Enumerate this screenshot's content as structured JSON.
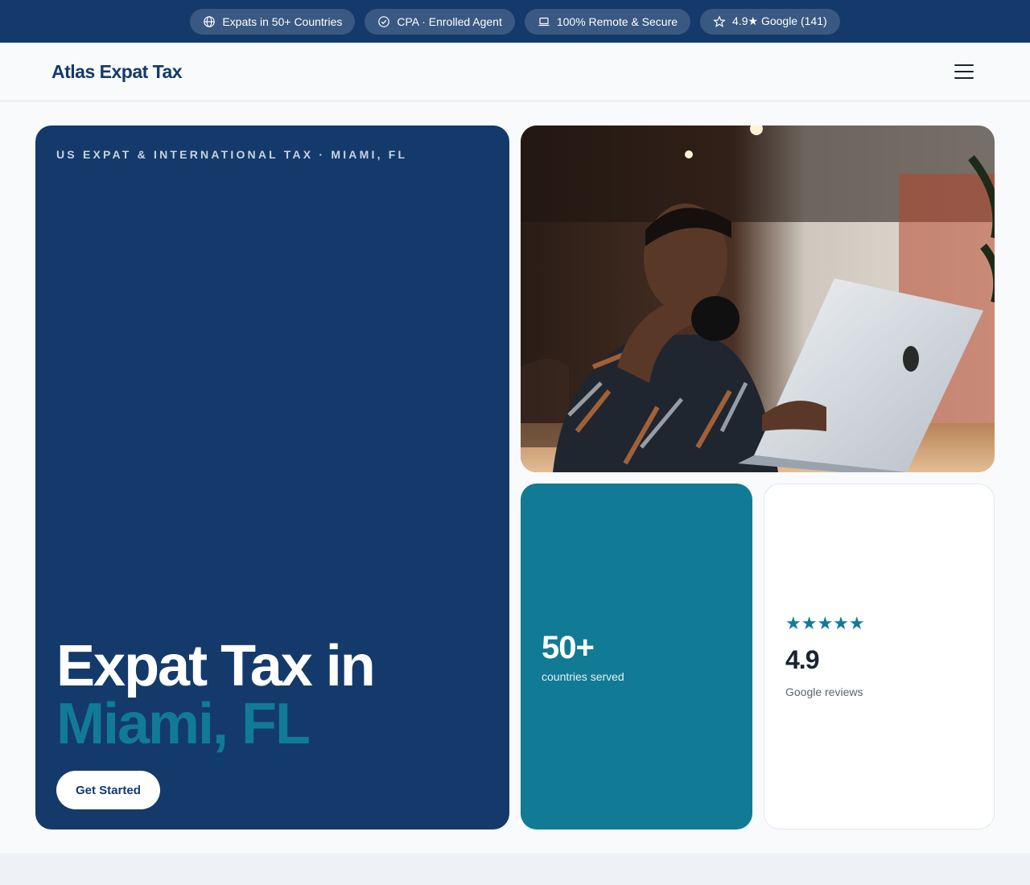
{
  "topbar": {
    "badges": [
      {
        "icon": "globe-icon",
        "label": "Expats in 50+ Countries"
      },
      {
        "icon": "check-badge-icon",
        "label": "CPA · Enrolled Agent"
      },
      {
        "icon": "laptop-icon",
        "label": "100% Remote & Secure"
      },
      {
        "icon": "star-icon",
        "label": "4.9★ Google (141)"
      }
    ]
  },
  "header": {
    "logo": "Atlas Expat Tax",
    "menu_icon": "hamburger-menu-icon"
  },
  "hero": {
    "eyebrow": "US EXPAT & INTERNATIONAL TAX · MIAMI, FL",
    "title_line1": "Expat Tax in",
    "title_line2": "Miami, FL",
    "cta_label": "Get Started"
  },
  "photo": {
    "description_icon": "photo-man-with-laptop"
  },
  "stats": {
    "countries": {
      "value": "50+",
      "label": "countries served"
    },
    "reviews": {
      "stars": "★★★★★",
      "value": "4.9",
      "label": "Google reviews"
    }
  },
  "colors": {
    "navy": "#143a6b",
    "teal": "#117b96",
    "background": "#f8fafc"
  }
}
